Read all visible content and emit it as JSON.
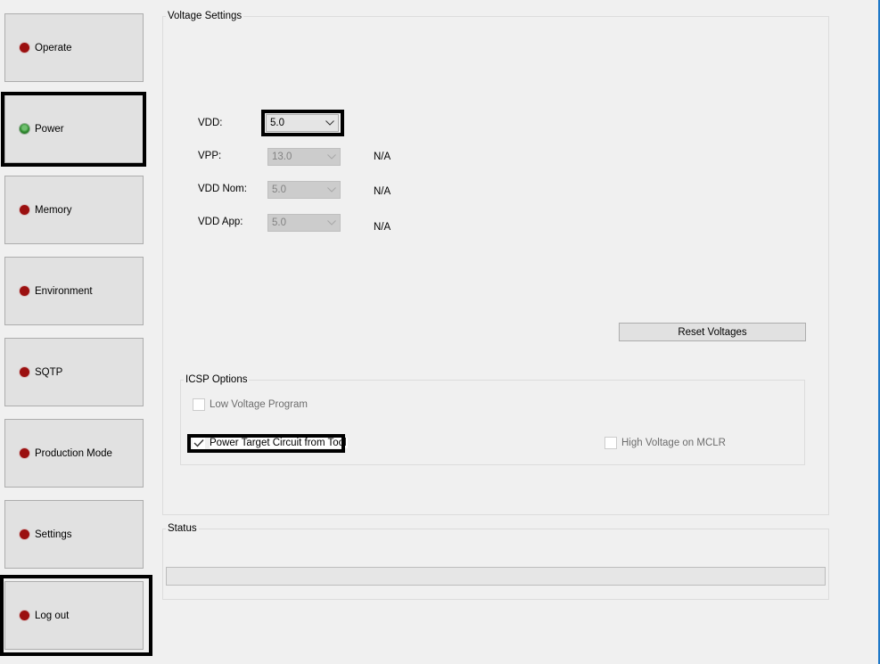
{
  "sidebar": {
    "items": [
      {
        "label": "Operate",
        "status": "red"
      },
      {
        "label": "Power",
        "status": "green"
      },
      {
        "label": "Memory",
        "status": "red"
      },
      {
        "label": "Environment",
        "status": "red"
      },
      {
        "label": "SQTP",
        "status": "red"
      },
      {
        "label": "Production Mode",
        "status": "red"
      },
      {
        "label": "Settings",
        "status": "red"
      },
      {
        "label": "Log out",
        "status": "red"
      }
    ]
  },
  "voltage_settings": {
    "title": "Voltage Settings",
    "fields": [
      {
        "label": "VDD:",
        "value": "5.0",
        "enabled": true,
        "readout": ""
      },
      {
        "label": "VPP:",
        "value": "13.0",
        "enabled": false,
        "readout": "N/A"
      },
      {
        "label": "VDD Nom:",
        "value": "5.0",
        "enabled": false,
        "readout": "N/A"
      },
      {
        "label": "VDD App:",
        "value": "5.0",
        "enabled": false,
        "readout": "N/A"
      }
    ],
    "reset_button": "Reset Voltages"
  },
  "icsp_options": {
    "title": "ICSP Options",
    "low_voltage_program": {
      "label": "Low Voltage Program",
      "checked": false,
      "enabled": false
    },
    "power_target": {
      "label": "Power Target Circuit from Tool",
      "checked": true,
      "enabled": true
    },
    "high_voltage_mclr": {
      "label": "High Voltage on MCLR",
      "checked": false,
      "enabled": false
    }
  },
  "status": {
    "title": "Status",
    "progress": 0
  },
  "colors": {
    "led_red": "#9b1010",
    "led_green": "#2f8a2f",
    "window_accent": "#1e78c8"
  }
}
